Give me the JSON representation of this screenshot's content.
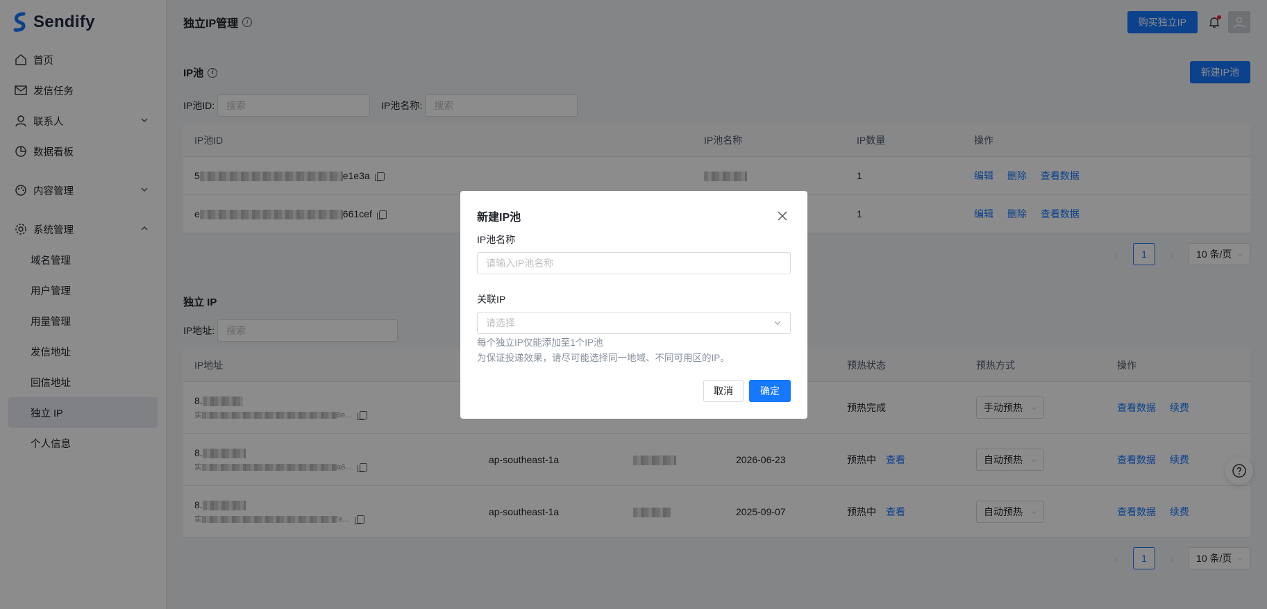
{
  "brand": {
    "name": "Sendify"
  },
  "sidebar": {
    "items": [
      {
        "label": "首页",
        "icon": "home-icon"
      },
      {
        "label": "发信任务",
        "icon": "mail-icon"
      },
      {
        "label": "联系人",
        "icon": "user-icon"
      },
      {
        "label": "数据看板",
        "icon": "pie-chart-icon"
      },
      {
        "label": "内容管理",
        "icon": "palette-icon"
      },
      {
        "label": "系统管理",
        "icon": "gear-icon"
      }
    ],
    "sub_items": [
      {
        "label": "域名管理"
      },
      {
        "label": "用户管理"
      },
      {
        "label": "用量管理"
      },
      {
        "label": "发信地址"
      },
      {
        "label": "回信地址"
      },
      {
        "label": "独立 IP"
      },
      {
        "label": "个人信息"
      }
    ]
  },
  "header": {
    "title": "独立IP管理",
    "buy_button": "购买独立IP"
  },
  "pool_section": {
    "title": "IP池",
    "new_button": "新建IP池",
    "filter_id_label": "IP池ID:",
    "filter_name_label": "IP池名称:",
    "search_placeholder": "搜索",
    "columns": [
      "IP池ID",
      "IP池名称",
      "IP数量",
      "操作"
    ],
    "rows": [
      {
        "id_prefix": "5",
        "id_suffix": "e1e3a",
        "count": "1"
      },
      {
        "id_prefix": "e",
        "id_suffix": "661cef",
        "count": "1"
      }
    ],
    "actions": {
      "edit": "编辑",
      "delete": "删除",
      "view": "查看数据"
    },
    "pager": {
      "page": "1",
      "size": "10 条/页"
    }
  },
  "ip_section": {
    "title": "独立 IP",
    "filter_label": "IP地址:",
    "search_placeholder": "搜索",
    "columns": [
      "IP地址",
      "预热状态",
      "预热方式",
      "操作"
    ],
    "rows": [
      {
        "ip_prefix": "8.",
        "sub_prefix": "实",
        "sub_suffix": "8e...",
        "region": "",
        "date": "",
        "status": "预热完成",
        "view_link": "",
        "mode": "手动预热"
      },
      {
        "ip_prefix": "8.",
        "sub_prefix": "实",
        "sub_suffix": "a6...",
        "region": "ap-southeast-1a",
        "date": "2026-06-23",
        "status": "预热中",
        "view_link": "查看",
        "mode": "自动预热"
      },
      {
        "ip_prefix": "8.",
        "sub_prefix": "实",
        "sub_suffix": "'e...",
        "region": "ap-southeast-1a",
        "date": "2025-09-07",
        "status": "预热中",
        "view_link": "查看",
        "mode": "自动预热"
      }
    ],
    "actions": {
      "view": "查看数据",
      "renew": "续费"
    },
    "pager": {
      "page": "1",
      "size": "10 条/页"
    }
  },
  "modal": {
    "title": "新建IP池",
    "name_label": "IP池名称",
    "name_placeholder": "请输入IP池名称",
    "ip_label": "关联IP",
    "ip_placeholder": "请选择",
    "hint_1": "每个独立IP仅能添加至1个IP池",
    "hint_2": "为保证投递效果，请尽可能选择同一地域、不同可用区的IP。",
    "cancel": "取消",
    "confirm": "确定"
  },
  "colors": {
    "primary": "#1677ff",
    "overlay": "rgba(0,0,0,0.45)"
  }
}
